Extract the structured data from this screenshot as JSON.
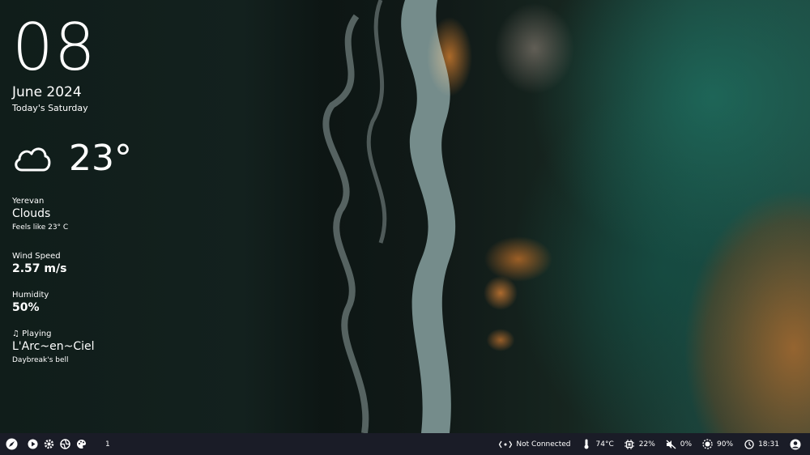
{
  "widgets": {
    "day": "08",
    "month_year": "June 2024",
    "weekday_text": "Today's Saturday",
    "temperature": "23°",
    "city": "Yerevan",
    "condition": "Clouds",
    "feels_like": "Feels like 23° C",
    "wind_label": "Wind Speed",
    "wind_value": "2.57 m/s",
    "humidity_label": "Humidity",
    "humidity_value": "50%",
    "playing_label": "Playing",
    "artist": "L'Arc~en~Ciel",
    "track": "Daybreak's bell"
  },
  "taskbar": {
    "left_icons": [
      "launcher-rocket-icon",
      "play-icon",
      "gear-icon",
      "aperture-icon",
      "palette-icon"
    ],
    "workspace": "1",
    "network": "Not Connected",
    "temperature": "74°C",
    "cpu": "22%",
    "mute_level": "0%",
    "brightness": "90%",
    "time": "18:31"
  },
  "colors": {
    "bar_bg": "#1a1c27",
    "text": "#ffffff"
  }
}
